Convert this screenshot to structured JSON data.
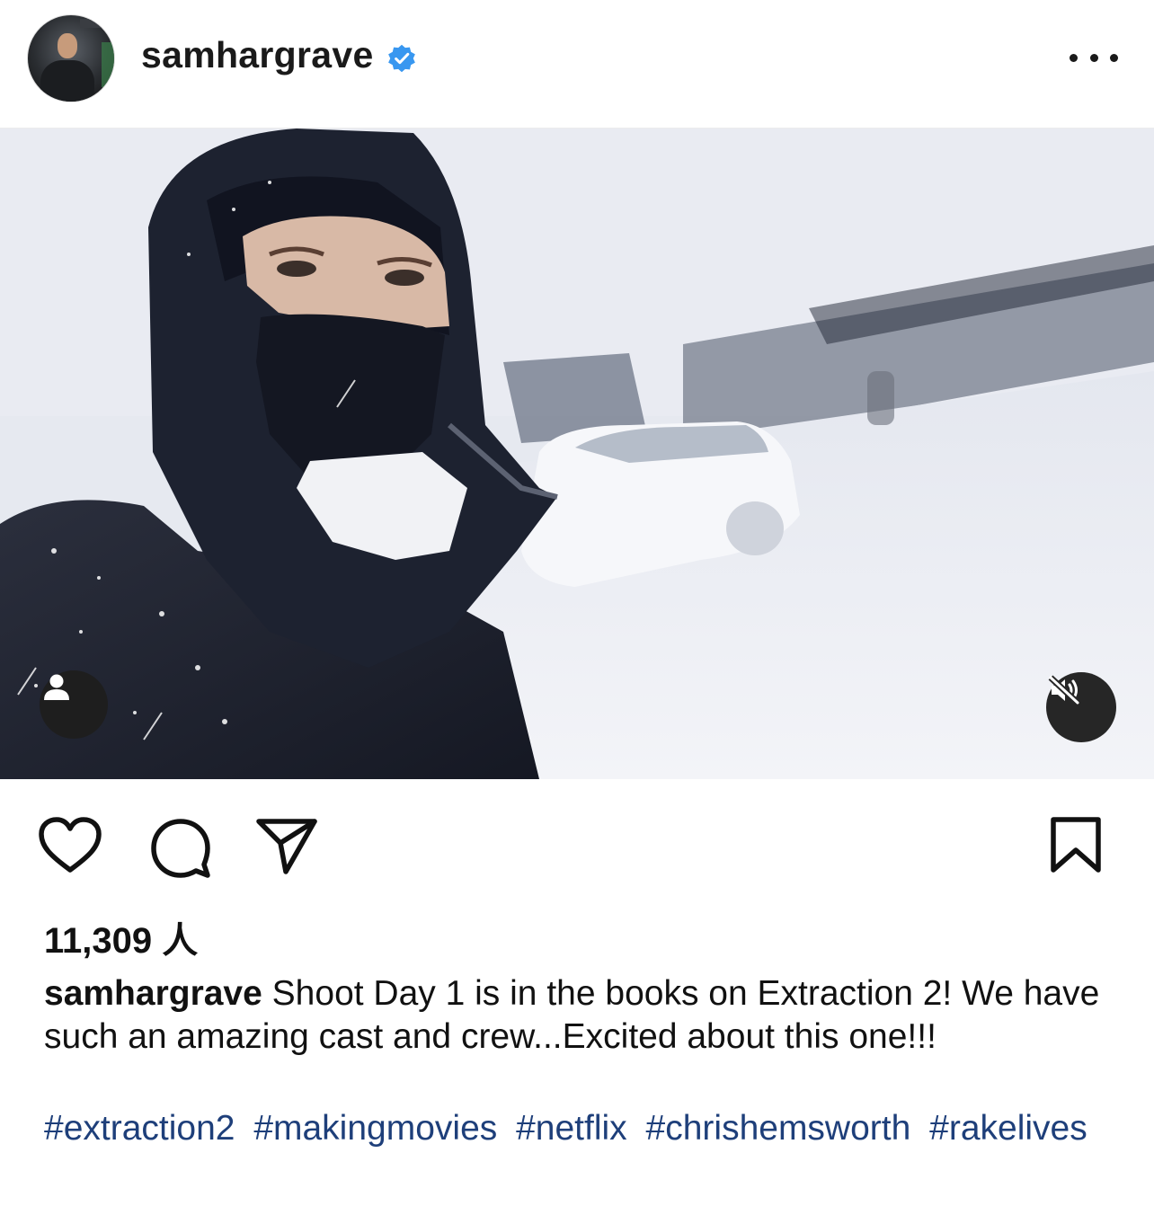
{
  "post": {
    "username": "samhargrave",
    "verified": true,
    "likes_text": "11,309 人",
    "caption_user": "samhargrave",
    "caption_text": "Shoot Day 1 is in the books on Extraction 2! We have such an amazing cast and crew...Excited about this one!!!",
    "hashtags": [
      "#extraction2",
      "#makingmovies",
      "#netflix",
      "#chrishemsworth",
      "#rakelives"
    ]
  },
  "colors": {
    "verified_blue": "#3897f0",
    "hashtag": "#1e3f7a",
    "icon": "#111111"
  },
  "icons": {
    "more": "more-options-icon",
    "tag": "user-tag-icon",
    "mute": "muted-speaker-icon",
    "like": "heart-icon",
    "comment": "comment-bubble-icon",
    "share": "paper-plane-icon",
    "save": "bookmark-icon"
  }
}
